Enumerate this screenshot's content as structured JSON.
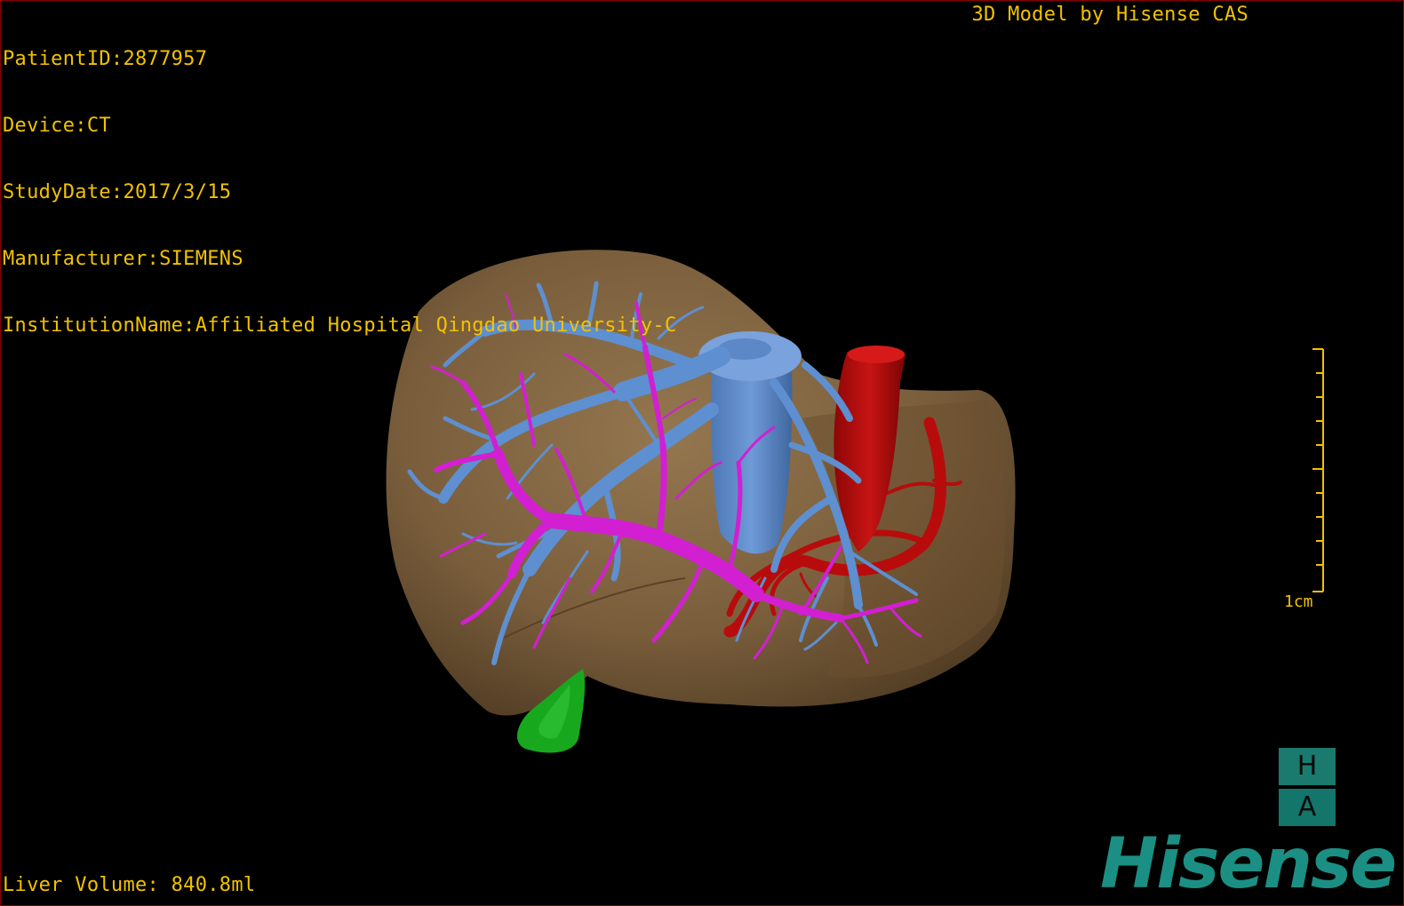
{
  "overlay": {
    "patient_id": "PatientID:2877957",
    "device": "Device:CT",
    "study_date": "StudyDate:2017/3/15",
    "manufacturer": "Manufacturer:SIEMENS",
    "institution": "InstitutionName:Affiliated Hospital Qingdao University-C",
    "model_credit": "3D Model by Hisense CAS",
    "liver_volume": "Liver Volume: 840.8ml"
  },
  "scale_bar": {
    "label": "1cm"
  },
  "orientation": {
    "top_letter": "H",
    "bottom_letter": "A"
  },
  "brand": {
    "logo_text": "Hisense"
  },
  "colors": {
    "overlay_text": "#f2c200",
    "liver": "#7a5e3c",
    "hepatic_vein": "#5e8fd0",
    "portal_vein": "#d21fd2",
    "artery": "#b80c0c",
    "gallbladder": "#18a81e",
    "brand": "#1b8f84",
    "frame": "#8a0000"
  },
  "structures": [
    "liver",
    "hepatic-vein",
    "portal-vein",
    "artery",
    "gallbladder"
  ]
}
